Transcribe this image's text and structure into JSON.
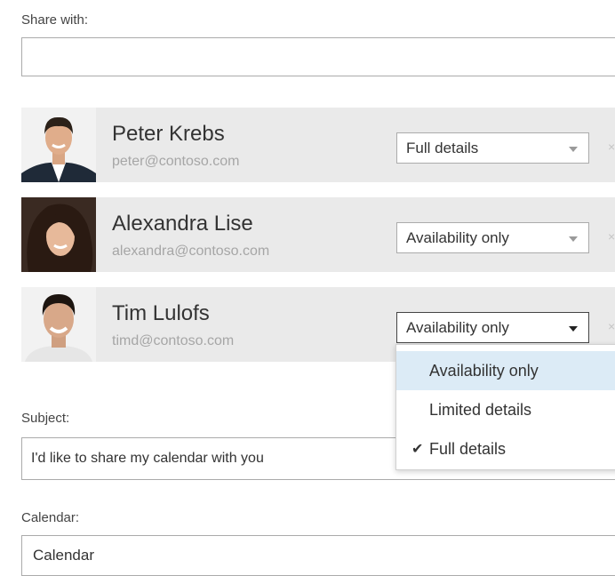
{
  "share": {
    "label": "Share with:",
    "input_value": ""
  },
  "people": [
    {
      "name": "Peter Krebs",
      "email": "peter@contoso.com",
      "permission": "Full details"
    },
    {
      "name": "Alexandra Lise",
      "email": "alexandra@contoso.com",
      "permission": "Availability only"
    },
    {
      "name": "Tim Lulofs",
      "email": "timd@contoso.com",
      "permission": "Availability only"
    }
  ],
  "remove_glyph": "×",
  "dropdown_menu": {
    "items": [
      {
        "label": "Availability only",
        "highlighted": true,
        "checked": false
      },
      {
        "label": "Limited details",
        "highlighted": false,
        "checked": false
      },
      {
        "label": "Full details",
        "highlighted": false,
        "checked": true
      }
    ],
    "check_glyph": "✔"
  },
  "subject": {
    "label": "Subject:",
    "value": "I'd like to share my calendar with you"
  },
  "calendar": {
    "label": "Calendar:",
    "value": "Calendar"
  },
  "colors": {
    "row_bg": "#eaeaea",
    "highlight": "#dcebf6",
    "email_gray": "#a6a6a6"
  }
}
